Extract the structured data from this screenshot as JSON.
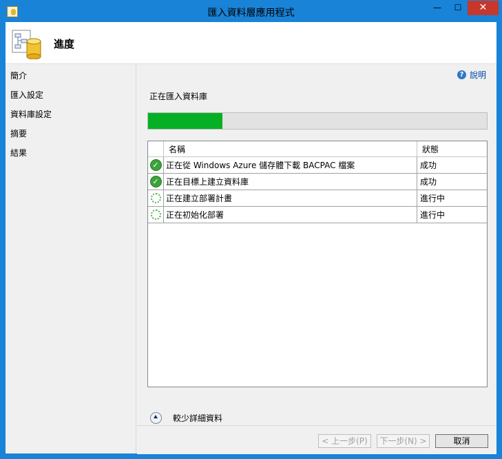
{
  "window": {
    "title": "匯入資料層應用程式",
    "min_glyph": "—",
    "max_glyph": "☐",
    "close_glyph": "✕"
  },
  "header": {
    "title": "進度"
  },
  "sidebar": {
    "items": [
      {
        "label": "簡介"
      },
      {
        "label": "匯入設定"
      },
      {
        "label": "資料庫設定"
      },
      {
        "label": "摘要"
      },
      {
        "label": "結果"
      }
    ]
  },
  "main": {
    "help_label": "說明",
    "status_text": "正在匯入資料庫",
    "progress": 0.22,
    "table": {
      "columns": [
        "名稱",
        "狀態"
      ],
      "rows": [
        {
          "icon": "success-check-icon",
          "name": "正在從 Windows Azure 儲存體下載 BACPAC 檔案",
          "status": "成功"
        },
        {
          "icon": "success-check-icon",
          "name": "正在目標上建立資料庫",
          "status": "成功"
        },
        {
          "icon": "in-progress-spinner-icon",
          "name": "正在建立部署計畫",
          "status": "進行中"
        },
        {
          "icon": "in-progress-spinner-icon",
          "name": "正在初始化部署",
          "status": "進行中"
        }
      ]
    },
    "details_toggle_label": "較少詳細資料"
  },
  "footer": {
    "prev_label": "< 上一步(P)",
    "next_label": "下一步(N) >",
    "cancel_label": "取消"
  },
  "colors": {
    "title_bar": "#1883d7",
    "close_button": "#c7372b",
    "progress_fill": "#06b025",
    "success": "#3ca33a"
  }
}
